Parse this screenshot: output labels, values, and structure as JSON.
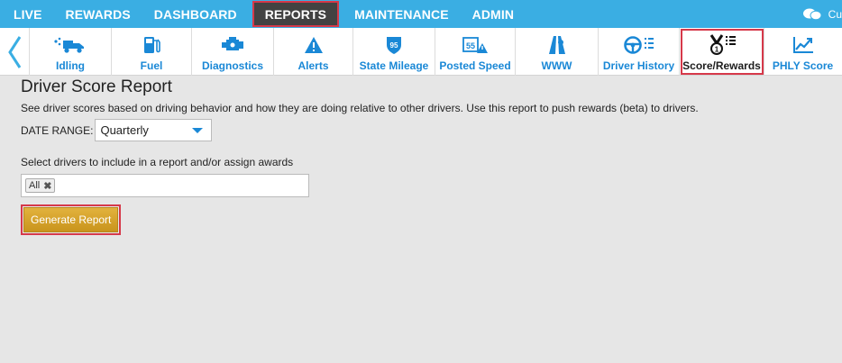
{
  "topnav": {
    "items": [
      {
        "label": "LIVE"
      },
      {
        "label": "REWARDS"
      },
      {
        "label": "DASHBOARD"
      },
      {
        "label": "REPORTS",
        "active": true
      },
      {
        "label": "MAINTENANCE"
      },
      {
        "label": "ADMIN"
      }
    ],
    "user_fragment": "Cu"
  },
  "toolbar": {
    "items": [
      {
        "label": "Idling",
        "icon": "idling-truck-icon"
      },
      {
        "label": "Fuel",
        "icon": "fuel-pump-icon"
      },
      {
        "label": "Diagnostics",
        "icon": "engine-icon"
      },
      {
        "label": "Alerts",
        "icon": "alert-triangle-icon"
      },
      {
        "label": "State Mileage",
        "icon": "interstate-shield-icon"
      },
      {
        "label": "Posted Speed",
        "icon": "speed-limit-icon"
      },
      {
        "label": "WWW",
        "icon": "road-icon"
      },
      {
        "label": "Driver History",
        "icon": "steering-wheel-icon"
      },
      {
        "label": "Score/Rewards",
        "icon": "medal-list-icon",
        "active": true
      },
      {
        "label": "PHLY Score",
        "icon": "trend-chart-icon"
      }
    ]
  },
  "report": {
    "title": "Driver Score Report",
    "description": "See driver scores based on driving behavior and how they are doing relative to other drivers. Use this report to push rewards (beta) to drivers.",
    "date_range_label": "DATE RANGE:",
    "date_range_value": "Quarterly",
    "select_label": "Select drivers to include in a report and/or assign awards",
    "selected_tag": "All",
    "tag_remove": "✖",
    "generate_label": "Generate Report"
  },
  "colors": {
    "nav_bg": "#3aaee3",
    "active_nav_bg": "#424242",
    "highlight": "#d6394a",
    "link_blue": "#1a88d6",
    "button_gold": "#d4a32e"
  }
}
